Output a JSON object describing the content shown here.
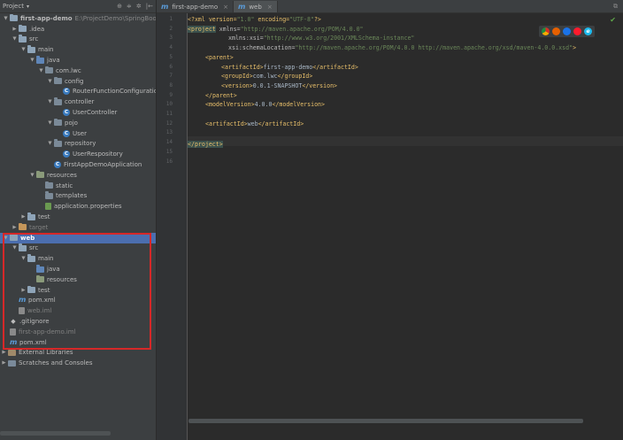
{
  "panel": {
    "title": "Project",
    "dropdown": "▾",
    "tools": [
      "⊕",
      "≑",
      "✲",
      "|←"
    ]
  },
  "tree": [
    {
      "label": "first-app-demo",
      "path": "E:\\ProjectDemo\\SpringBootD",
      "depth": 0,
      "arrow": "▼",
      "icon": "folder",
      "bold": true
    },
    {
      "label": ".idea",
      "depth": 1,
      "arrow": "▶",
      "icon": "folder"
    },
    {
      "label": "src",
      "depth": 1,
      "arrow": "▼",
      "icon": "folder"
    },
    {
      "label": "main",
      "depth": 2,
      "arrow": "▼",
      "icon": "folder"
    },
    {
      "label": "java",
      "depth": 3,
      "arrow": "▼",
      "icon": "folder-blue"
    },
    {
      "label": "com.lwc",
      "depth": 4,
      "arrow": "▼",
      "icon": "folder-plain"
    },
    {
      "label": "config",
      "depth": 5,
      "arrow": "▼",
      "icon": "folder-plain"
    },
    {
      "label": "RouterFunctionConfiguration",
      "depth": 6,
      "arrow": "",
      "icon": "class"
    },
    {
      "label": "controller",
      "depth": 5,
      "arrow": "▼",
      "icon": "folder-plain"
    },
    {
      "label": "UserController",
      "depth": 6,
      "arrow": "",
      "icon": "class"
    },
    {
      "label": "pojo",
      "depth": 5,
      "arrow": "▼",
      "icon": "folder-plain"
    },
    {
      "label": "User",
      "depth": 6,
      "arrow": "",
      "icon": "class"
    },
    {
      "label": "repository",
      "depth": 5,
      "arrow": "▼",
      "icon": "folder-plain"
    },
    {
      "label": "UserRespository",
      "depth": 6,
      "arrow": "",
      "icon": "class"
    },
    {
      "label": "FirstAppDemoApplication",
      "depth": 5,
      "arrow": "",
      "icon": "class"
    },
    {
      "label": "resources",
      "depth": 3,
      "arrow": "▼",
      "icon": "folder-res"
    },
    {
      "label": "static",
      "depth": 4,
      "arrow": "",
      "icon": "folder-plain"
    },
    {
      "label": "templates",
      "depth": 4,
      "arrow": "",
      "icon": "folder-plain"
    },
    {
      "label": "application.properties",
      "depth": 4,
      "arrow": "",
      "icon": "prop"
    },
    {
      "label": "test",
      "depth": 2,
      "arrow": "▶",
      "icon": "folder"
    },
    {
      "label": "target",
      "depth": 1,
      "arrow": "▶",
      "icon": "folder-orange",
      "dim": true
    },
    {
      "label": "web",
      "depth": 0,
      "arrow": "▼",
      "icon": "folder",
      "bold": true,
      "selected": true
    },
    {
      "label": "src",
      "depth": 1,
      "arrow": "▼",
      "icon": "folder"
    },
    {
      "label": "main",
      "depth": 2,
      "arrow": "▼",
      "icon": "folder"
    },
    {
      "label": "java",
      "depth": 3,
      "arrow": "",
      "icon": "folder-blue"
    },
    {
      "label": "resources",
      "depth": 3,
      "arrow": "",
      "icon": "folder-res"
    },
    {
      "label": "test",
      "depth": 2,
      "arrow": "▶",
      "icon": "folder"
    },
    {
      "label": "pom.xml",
      "depth": 1,
      "arrow": "",
      "icon": "maven"
    },
    {
      "label": "web.iml",
      "depth": 1,
      "arrow": "",
      "icon": "iml",
      "dim": true
    },
    {
      "label": ".gitignore",
      "depth": 0,
      "arrow": "",
      "icon": "git"
    },
    {
      "label": "first-app-demo.iml",
      "depth": 0,
      "arrow": "",
      "icon": "iml",
      "dim": true
    },
    {
      "label": "pom.xml",
      "depth": 0,
      "arrow": "",
      "icon": "maven"
    },
    {
      "label": "External Libraries",
      "depth": -1,
      "arrow": "▶",
      "icon": "lib"
    },
    {
      "label": "Scratches and Consoles",
      "depth": -1,
      "arrow": "▶",
      "icon": "scratch"
    }
  ],
  "tabs": [
    {
      "label": "first-app-demo",
      "icon": "m",
      "active": false,
      "close": "×"
    },
    {
      "label": "web",
      "icon": "m",
      "active": true,
      "close": "×"
    }
  ],
  "split_icon": "⧉",
  "check_mark": "✔",
  "line_numbers": [
    "1",
    "2",
    "3",
    "4",
    "5",
    "6",
    "7",
    "8",
    "9",
    "10",
    "11",
    "12",
    "13",
    "14",
    "15",
    "16"
  ],
  "code": {
    "l1": {
      "a": "<?xml version=",
      "b": "\"1.0\"",
      "c": " encoding=",
      "d": "\"UTF-8\"",
      "e": "?>"
    },
    "l2": {
      "tag": "<project",
      "attr": " xmlns=",
      "val": "\"http://maven.apache.org/POM/4.0.0\""
    },
    "l3": {
      "attr": "xmlns:xsi=",
      "val": "\"http://www.w3.org/2001/XMLSchema-instance\""
    },
    "l4": {
      "attr": "xsi:schemaLocation=",
      "val": "\"http://maven.apache.org/POM/4.0.0 http://maven.apache.org/xsd/maven-4.0.0.xsd\"",
      "end": ">"
    },
    "l5": {
      "tag": "<parent>"
    },
    "l6": {
      "o": "<artifactId>",
      "t": "first-app-demo",
      "c": "</artifactId>"
    },
    "l7": {
      "o": "<groupId>",
      "t": "com.lwc",
      "c": "</groupId>"
    },
    "l8": {
      "o": "<version>",
      "t": "0.0.1-SNAPSHOT",
      "c": "</version>"
    },
    "l9": {
      "tag": "</parent>"
    },
    "l10": {
      "o": "<modelVersion>",
      "t": "4.0.0",
      "c": "</modelVersion>"
    },
    "l12": {
      "o": "<artifactId>",
      "t": "web",
      "c": "</artifactId>"
    },
    "l16": {
      "tag": "</project>"
    }
  }
}
